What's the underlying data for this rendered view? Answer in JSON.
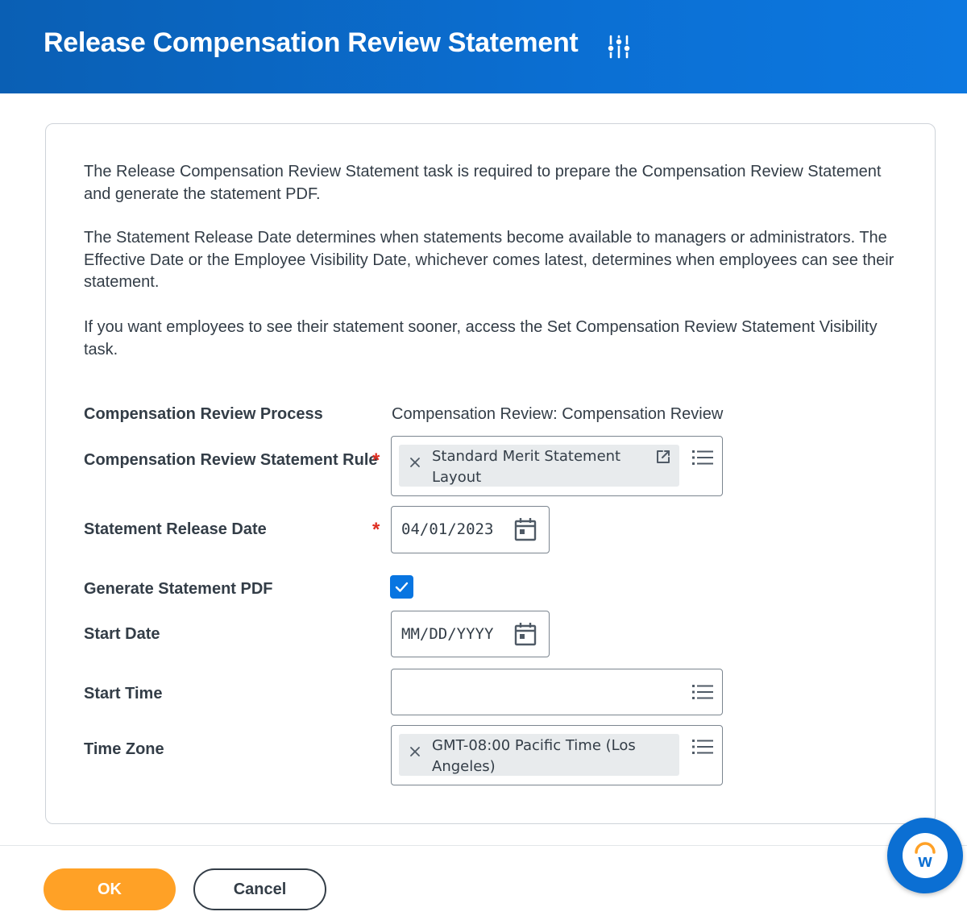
{
  "header": {
    "title": "Release Compensation Review Statement",
    "icon": "related-actions-icon",
    "background_color": "#0b6fd3"
  },
  "instructions": {
    "paragraphs": [
      "The Release Compensation Review Statement task is required to prepare the Compensation Review Statement and generate the statement PDF.",
      "The Statement Release Date determines when statements become available to managers or administrators. The Effective Date or the Employee Visibility Date, whichever comes latest, determines when employees can see their statement.",
      "If you want employees to see their statement sooner, access the Set Compensation Review Statement Visibility task."
    ]
  },
  "form": {
    "review_process": {
      "label": "Compensation Review Process",
      "value": "Compensation Review: Compensation Review"
    },
    "statement_rule": {
      "label": "Compensation Review Statement Rule",
      "required": true,
      "required_mark": "*",
      "selected": "Standard Merit Statement Layout"
    },
    "release_date": {
      "label": "Statement Release Date",
      "required": true,
      "required_mark": "*",
      "value": "04/01/2023"
    },
    "generate_pdf": {
      "label": "Generate Statement PDF",
      "checked": true
    },
    "start_date": {
      "label": "Start Date",
      "placeholder": "MM/DD/YYYY"
    },
    "start_time": {
      "label": "Start Time",
      "value": ""
    },
    "time_zone": {
      "label": "Time Zone",
      "selected": "GMT-08:00 Pacific Time (Los Angeles)"
    }
  },
  "footer": {
    "ok_label": "OK",
    "cancel_label": "Cancel"
  },
  "colors": {
    "primary_blue": "#0875e1",
    "ok_orange": "#ffa126",
    "required_red": "#de2e21",
    "text": "#333d47"
  },
  "assistant": {
    "icon": "workday-assistant-icon",
    "logo_letter": "w"
  }
}
